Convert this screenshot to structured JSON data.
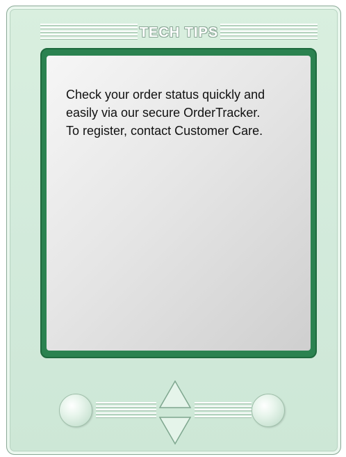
{
  "header": {
    "title": "TECH TIPS"
  },
  "screen": {
    "lines": [
      "Check your order status quickly and",
      "easily via our secure OrderTracker.",
      "To register, contact Customer Care."
    ]
  },
  "controls": {
    "left_button_icon": "circle-button-icon",
    "right_button_icon": "circle-button-icon",
    "up_icon": "triangle-up-icon",
    "down_icon": "triangle-down-icon"
  },
  "colors": {
    "body": "#d2eadb",
    "screen_border": "#2b8250",
    "outline": "#8aa896"
  }
}
